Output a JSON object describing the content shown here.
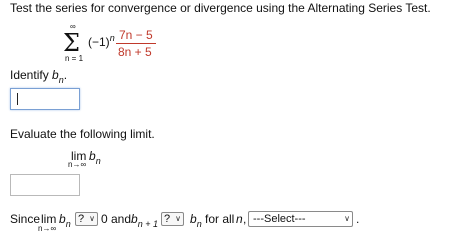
{
  "question": {
    "prompt": "Test the series for convergence or divergence using the Alternating Series Test."
  },
  "series": {
    "sum_symbol": "Σ",
    "upper_limit": "∞",
    "lower_limit": "n = 1",
    "sign_term": "(−1)",
    "sign_exponent": "n",
    "numerator": "7n − 5",
    "denominator": "8n + 5"
  },
  "identify": {
    "label_prefix": "Identify ",
    "label_var": "b",
    "label_sub": "n",
    "label_suffix": ".",
    "answer_value": ""
  },
  "limit_section": {
    "instruction": "Evaluate the following limit.",
    "lim": "lim",
    "lim_sub": "n→∞",
    "var": "b",
    "var_sub": "n",
    "answer_value": ""
  },
  "conclusion": {
    "since": "Since",
    "lim": "lim",
    "lim_sub": "n→∞",
    "b": "b",
    "b_sub": "n",
    "dropdown1": "?",
    "zero_and": "0 and",
    "b_next_sub": "n + 1",
    "dropdown2": "?",
    "b2_sub": "n",
    "for_all": "for all",
    "n_var": "n",
    "comma": ",",
    "select_value": "---Select---",
    "period": "."
  }
}
